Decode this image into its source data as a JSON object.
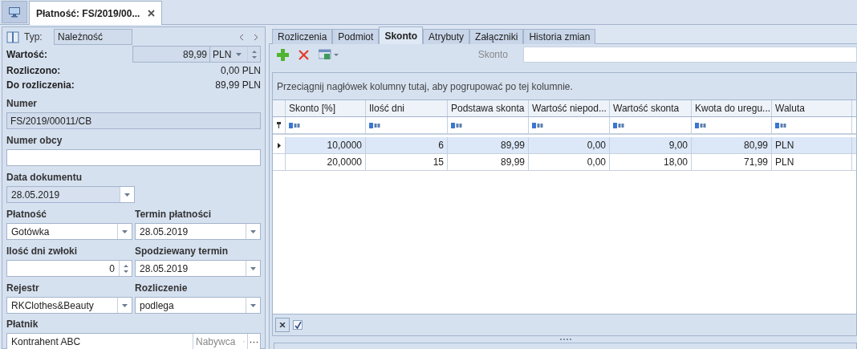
{
  "doc_tabs": [
    {
      "label": "Płatność: FS/2019/00...",
      "selected": true
    }
  ],
  "header": {
    "type_label": "Typ:",
    "type_value": "Należność",
    "value_label": "Wartość:",
    "value": "89,99",
    "currency": "PLN",
    "settled_label": "Rozliczono:",
    "settled": "0,00 PLN",
    "remaining_label": "Do rozliczenia:",
    "remaining": "89,99 PLN"
  },
  "number": {
    "label": "Numer",
    "value": "FS/2019/00011/CB",
    "disabled": true
  },
  "foreign_number": {
    "label": "Numer obcy",
    "disabled": false
  },
  "document_date": {
    "label": "Data dokumentu",
    "value": "28.05.2019",
    "disabled": true
  },
  "field_pairs": [
    [
      {
        "label": "Płatność",
        "value": "Gotówka",
        "kind": "combo"
      },
      {
        "label": "Termin płatności",
        "value": "28.05.2019",
        "kind": "combo"
      }
    ],
    [
      {
        "label": "Ilość dni zwłoki",
        "value": "0",
        "kind": "spin"
      },
      {
        "label": "Spodziewany termin",
        "value": "28.05.2019",
        "kind": "combo"
      }
    ],
    [
      {
        "label": "Rejestr",
        "value": "RKClothes&Beauty",
        "kind": "combo"
      },
      {
        "label": "Rozliczenie",
        "value": "podlega",
        "kind": "combo"
      }
    ]
  ],
  "payer": {
    "label": "Płatnik",
    "value": "Kontrahent ABC",
    "role": "Nabywca",
    "button": "···"
  },
  "tabs": [
    {
      "label": "Rozliczenia",
      "selected": false
    },
    {
      "label": "Podmiot",
      "selected": false
    },
    {
      "label": "Skonto",
      "selected": true
    },
    {
      "label": "Atrybuty",
      "selected": false
    },
    {
      "label": "Załączniki",
      "selected": false
    },
    {
      "label": "Historia zmian",
      "selected": false
    }
  ],
  "toolbar": {
    "search_label": "Skonto"
  },
  "grid": {
    "group_hint": "Przeciągnij nagłówek kolumny tutaj, aby pogrupować po tej kolumnie.",
    "columns": [
      "Skonto [%]",
      "Ilość dni",
      "Podstawa skonta",
      "Wartość niepod...",
      "Wartość skonta",
      "Kwota do uregu...",
      "Waluta"
    ],
    "rows": [
      {
        "selected": true,
        "cells": [
          "10,0000",
          "6",
          "89,99",
          "0,00",
          "9,00",
          "80,99",
          "PLN"
        ]
      },
      {
        "selected": false,
        "cells": [
          "20,0000",
          "15",
          "89,99",
          "0,00",
          "18,00",
          "71,99",
          "PLN"
        ]
      }
    ]
  },
  "footer": {
    "filter_enabled": true
  }
}
